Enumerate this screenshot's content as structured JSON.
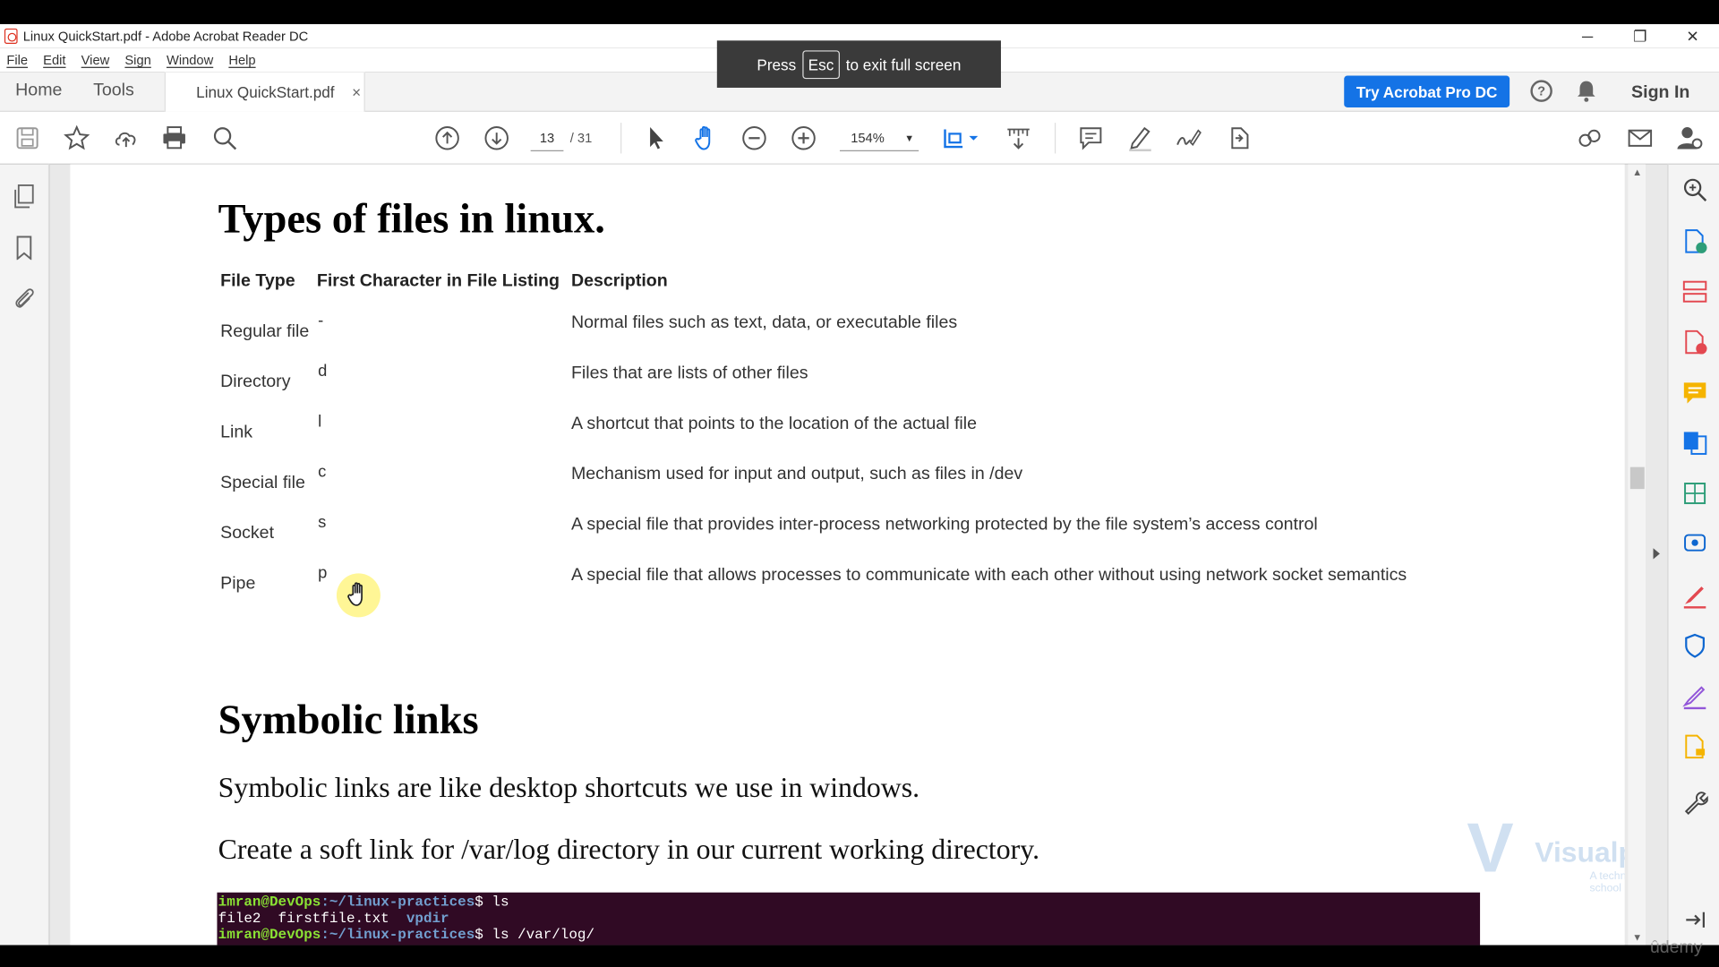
{
  "window": {
    "title": "Linux QuickStart.pdf - Adobe Acrobat Reader DC",
    "controls": [
      "─",
      "❐",
      "✕"
    ]
  },
  "menu": [
    "File",
    "Edit",
    "View",
    "Sign",
    "Window",
    "Help"
  ],
  "fullscreen_toast": {
    "press": "Press",
    "key": "Esc",
    "rest": "to exit full screen"
  },
  "tabs": {
    "home": "Home",
    "tools": "Tools",
    "doc_tab": "Linux QuickStart.pdf",
    "close": "×"
  },
  "header": {
    "try_button": "Try Acrobat Pro DC",
    "help": "?",
    "sign_in": "Sign In",
    "accent": "#1473e6"
  },
  "toolbar": {
    "page_current": "13",
    "page_total": "/ 31",
    "zoom": "154%",
    "zoom_caret": "▼"
  },
  "document": {
    "heading1": "Types of files in linux.",
    "table": {
      "headers": [
        "File Type",
        "First Character in File Listing",
        "Description"
      ],
      "rows": [
        {
          "type": "Regular file",
          "char": "-",
          "desc": "Normal files such as text, data, or executable files"
        },
        {
          "type": "Directory",
          "char": "d",
          "desc": "Files that are lists of other files"
        },
        {
          "type": "Link",
          "char": "l",
          "desc": "A shortcut that points to the location of the actual file"
        },
        {
          "type": "Special file",
          "char": "c",
          "desc": "Mechanism used for input and output, such as files in /dev"
        },
        {
          "type": "Socket",
          "char": "s",
          "desc": "A special file that provides inter-process networking protected by the file system’s access control"
        },
        {
          "type": "Pipe",
          "char": "p",
          "desc": "A special file that allows processes to communicate with each other without using network socket semantics"
        }
      ]
    },
    "heading2": "Symbolic links",
    "para1": "Symbolic links are like desktop shortcuts we use in windows.",
    "para2": "Create a soft link for /var/log directory in our current working directory.",
    "terminal": {
      "line1_user": "imran@DevOps",
      "line1_path": ":~/linux-practices",
      "line1_cmd": "$ ls",
      "line2_files": "file2  firstfile.txt  ",
      "line2_dir": "vpdir",
      "line3_user": "imran@DevOps",
      "line3_path": ":~/linux-practices",
      "line3_cmd": "$ ls /var/log/"
    }
  },
  "watermark": {
    "letter": "V",
    "name": "Visualpath",
    "tagline": "A technology school"
  },
  "udemy": "ûdemy"
}
